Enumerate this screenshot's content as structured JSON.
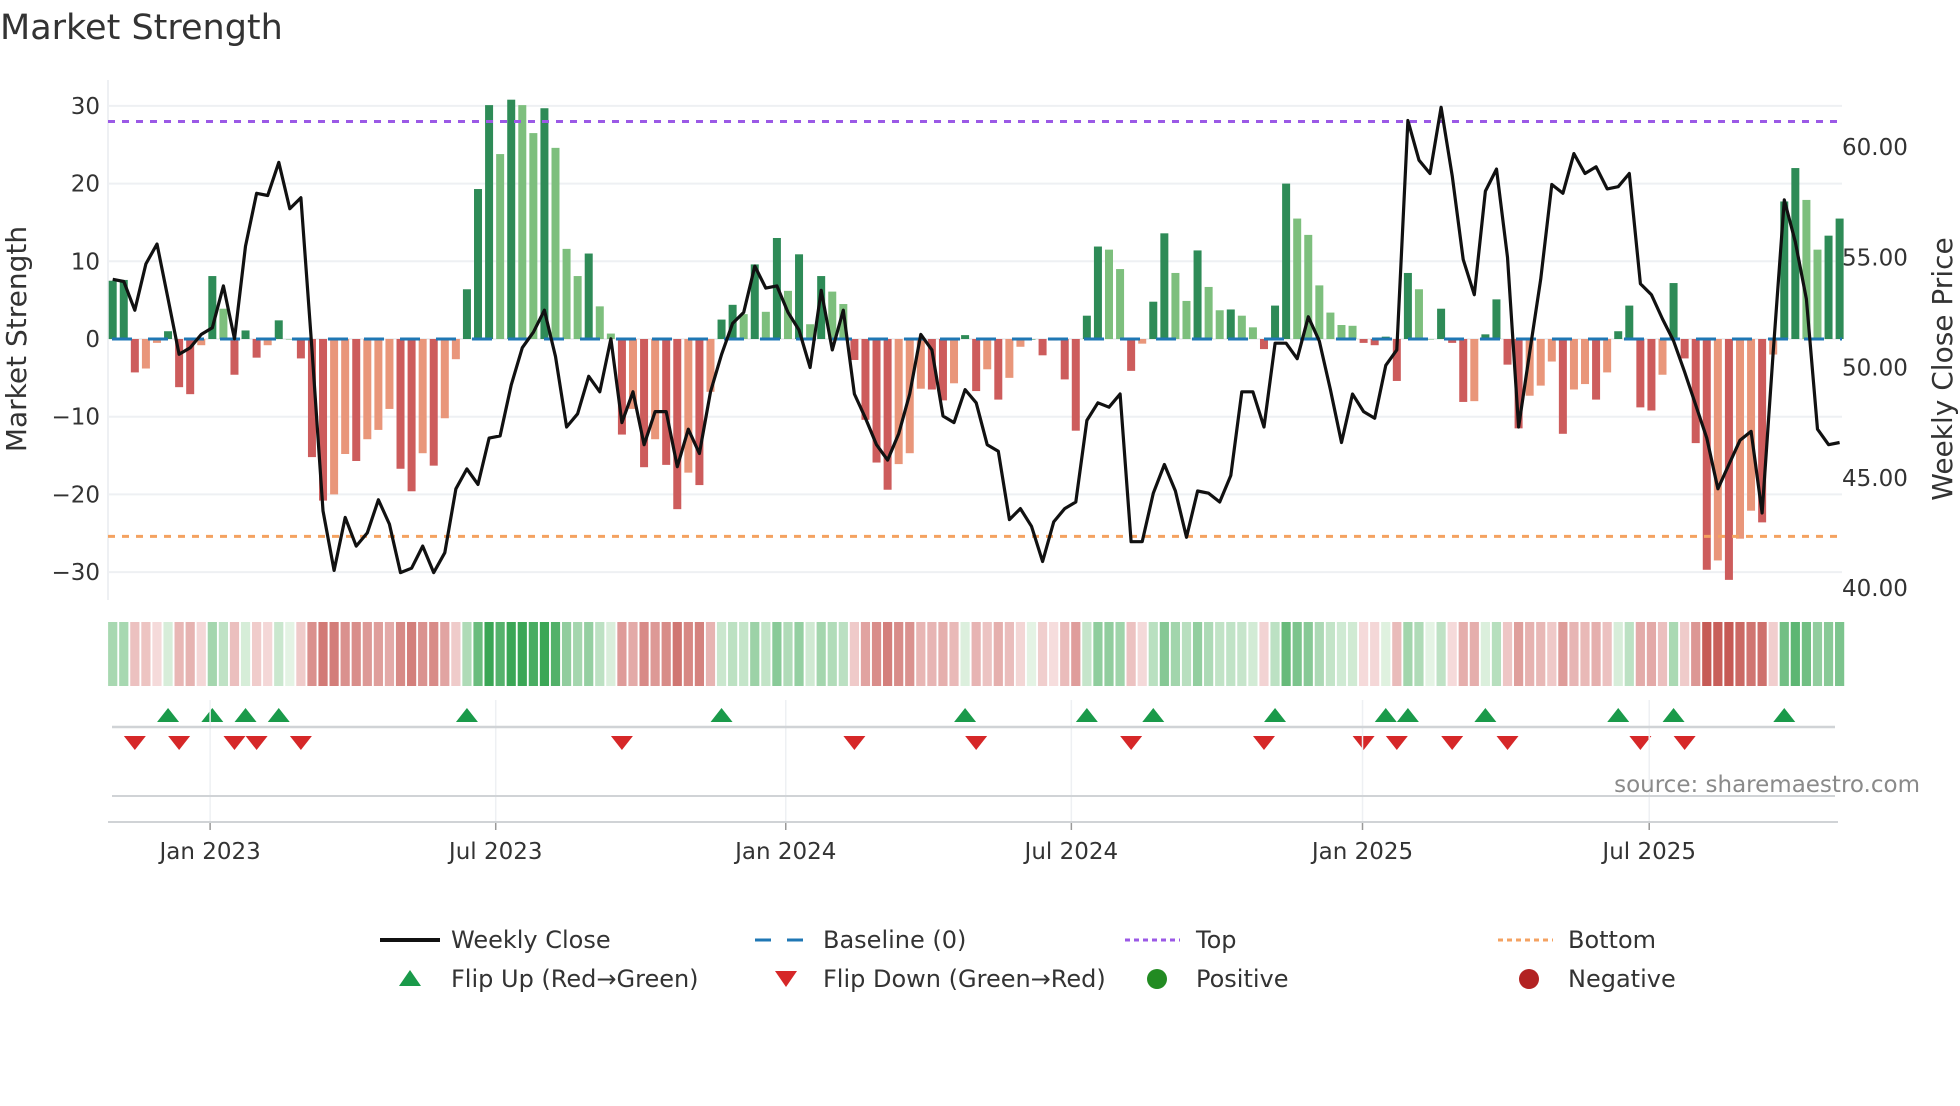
{
  "title": "Market Strength",
  "source": "source: sharemaestro.com",
  "colors": {
    "bar_pos_strong": "#2e8b57",
    "bar_pos_weak": "#7dbf7d",
    "bar_neg_strong": "#cd5c5c",
    "bar_neg_weak": "#e9967a",
    "close_line": "#111111",
    "baseline": "#1f77b4",
    "top": "#9b59e6",
    "bottom": "#f4a261",
    "flip_up": "#1a9a4a",
    "flip_down": "#d62728",
    "positive": "#228b22",
    "negative": "#b22222",
    "heat_pos": "#3aa655",
    "heat_neg": "#c65a55"
  },
  "legend": [
    {
      "label": "Weekly Close",
      "symbol": "line"
    },
    {
      "label": "Baseline (0)",
      "symbol": "dash"
    },
    {
      "label": "Top",
      "symbol": "dot-purple"
    },
    {
      "label": "Bottom",
      "symbol": "dot-orange"
    },
    {
      "label": "Flip Up (Red→Green)",
      "symbol": "triangle-up"
    },
    {
      "label": "Flip Down (Green→Red)",
      "symbol": "triangle-down"
    },
    {
      "label": "Positive",
      "symbol": "circle-green"
    },
    {
      "label": "Negative",
      "symbol": "circle-red"
    }
  ],
  "chart_data": {
    "type": "bar",
    "title": "Market Strength",
    "ylabel": "Market Strength",
    "y2label": "Weekly Close Price",
    "ylim": [
      -32,
      34
    ],
    "y2lim": [
      39.0,
      64.0
    ],
    "yticks": [
      "30",
      "20",
      "10",
      "0",
      "−10",
      "−20",
      "−30"
    ],
    "ytick_values": [
      30,
      20,
      10,
      0,
      -10,
      -20,
      -30
    ],
    "y2ticks": [
      "60.00",
      "55.00",
      "50.00",
      "45.00",
      "40.00"
    ],
    "y2tick_values": [
      60,
      55,
      50,
      45,
      40
    ],
    "xticks": [
      "Jan 2023",
      "Jul 2023",
      "Jan 2024",
      "Jul 2024",
      "Jan 2025",
      "Jul 2025"
    ],
    "xtick_week_index": [
      8.8,
      34.6,
      60.8,
      86.6,
      112.9,
      138.8
    ],
    "grid": true,
    "legend_position": "bottom",
    "top_level": 28.0,
    "bottom_level": -25.4,
    "baseline": 0,
    "strength": [
      7.5,
      7.6,
      -4.3,
      -3.8,
      -0.5,
      1.0,
      -6.2,
      -7.1,
      -0.8,
      8.1,
      3.9,
      -4.6,
      1.1,
      -2.4,
      -0.8,
      2.4,
      0,
      -2.5,
      -15.2,
      -20.8,
      -20,
      -14.8,
      -15.7,
      -12.9,
      -11.7,
      -9,
      -16.7,
      -19.6,
      -14.7,
      -16.3,
      -10.2,
      -2.6,
      6.4,
      19.3,
      30.1,
      23.8,
      30.8,
      30.1,
      26.5,
      29.7,
      24.6,
      11.6,
      8.1,
      11,
      4.2,
      0.7,
      -12.3,
      -9,
      -16.5,
      -12.9,
      -16.2,
      -21.9,
      -17.2,
      -18.8,
      -6.8,
      2.5,
      4.4,
      3.2,
      9.6,
      3.5,
      13.0,
      6.2,
      10.9,
      1.9,
      8.1,
      6.1,
      4.5,
      -2.7,
      -10.4,
      -15.9,
      -19.4,
      -16.1,
      -14.7,
      -6.4,
      -6.5,
      -7.9,
      -5.7,
      0.5,
      -6.7,
      -3.9,
      -7.8,
      -5.0,
      -1.0,
      0,
      -2.1,
      -0.2,
      -5.2,
      -11.8,
      3.0,
      11.9,
      11.5,
      9.0,
      -4.1,
      -0.6,
      4.8,
      13.6,
      8.5,
      4.9,
      11.4,
      6.7,
      3.7,
      3.8,
      3.0,
      1.5,
      -1.3,
      4.3,
      20.0,
      15.5,
      13.4,
      6.9,
      3.4,
      1.8,
      1.7,
      -0.5,
      -0.8,
      0.3,
      -5.4,
      8.5,
      6.4,
      0,
      3.9,
      -0.5,
      -8.1,
      -8.0,
      0.6,
      5.1,
      -3.3,
      -11.5,
      -7.3,
      -6.0,
      -2.9,
      -12.2,
      -6.5,
      -5.8,
      -7.8,
      -4.3,
      1.0,
      4.3,
      -8.8,
      -9.2,
      -4.6,
      7.2,
      -2.5,
      -13.4,
      -29.7,
      -28.5,
      -31,
      -25.7,
      -22.1,
      -23.6,
      -2.0,
      17.7,
      22.0,
      17.9,
      11.5,
      13.3,
      15.5
    ],
    "weekly_close": [
      54.0,
      53.9,
      52.6,
      54.7,
      55.6,
      53.1,
      50.6,
      50.9,
      51.5,
      51.8,
      53.7,
      51.3,
      55.5,
      57.9,
      57.8,
      59.3,
      57.2,
      57.7,
      50.8,
      43.5,
      40.8,
      43.2,
      41.9,
      42.5,
      44.0,
      42.9,
      40.7,
      40.9,
      41.9,
      40.7,
      41.6,
      44.5,
      45.4,
      44.7,
      46.8,
      46.9,
      49.2,
      50.9,
      51.6,
      52.6,
      50.5,
      47.3,
      47.9,
      49.6,
      48.9,
      51.3,
      47.5,
      48.9,
      46.5,
      48.0,
      48.0,
      45.5,
      47.2,
      46.1,
      48.9,
      50.6,
      52.0,
      52.5,
      54.6,
      53.6,
      53.7,
      52.5,
      51.7,
      50.0,
      53.5,
      50.8,
      52.6,
      48.8,
      47.7,
      46.5,
      45.8,
      47.0,
      48.8,
      51.5,
      50.8,
      47.8,
      47.5,
      49.0,
      48.4,
      46.5,
      46.2,
      43.1,
      43.6,
      42.8,
      41.2,
      43.0,
      43.6,
      43.9,
      47.6,
      48.4,
      48.2,
      48.8,
      42.1,
      42.1,
      44.3,
      45.6,
      44.4,
      42.3,
      44.4,
      44.3,
      43.9,
      45.1,
      48.9,
      48.9,
      47.3,
      51.1,
      51.1,
      50.4,
      52.3,
      51.2,
      49.0,
      46.6,
      48.8,
      48.0,
      47.7,
      50.1,
      50.8,
      61.2,
      59.4,
      58.8,
      61.8,
      58.7,
      54.9,
      53.3,
      58.0,
      59.0,
      55.0,
      47.3,
      50.7,
      54.0,
      58.3,
      57.9,
      59.7,
      58.8,
      59.1,
      58.1,
      58.2,
      58.8,
      53.8,
      53.3,
      52.2,
      51.2,
      49.8,
      48.3,
      46.8,
      44.5,
      45.6,
      46.7,
      47.1,
      43.4,
      50.7,
      57.6,
      55.7,
      53.1,
      47.2,
      46.5,
      46.6
    ],
    "flip_up_weeks": [
      5,
      9,
      12,
      15,
      32,
      55,
      77,
      88,
      94,
      105,
      115,
      117,
      124,
      136,
      141,
      151
    ],
    "flip_down_weeks": [
      2,
      6,
      11,
      13,
      17,
      46,
      67,
      78,
      92,
      104,
      113,
      116,
      121,
      126,
      138,
      142
    ]
  }
}
